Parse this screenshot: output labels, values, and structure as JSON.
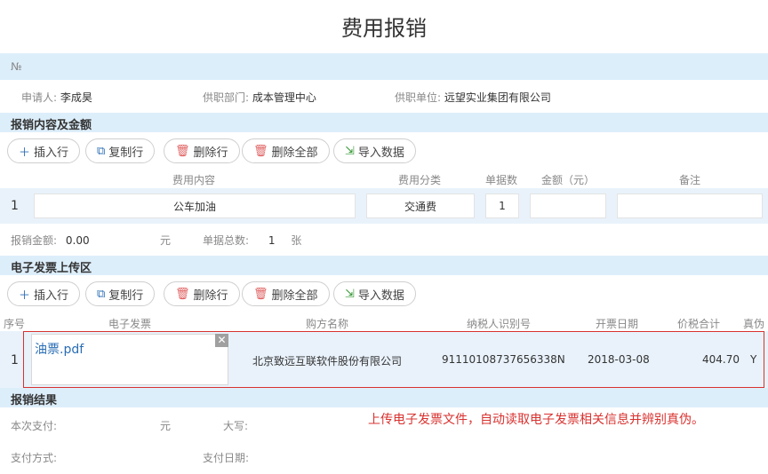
{
  "page_title": "费用报销",
  "no_label": "№",
  "applicant": {
    "label": "申请人:",
    "value": "李成昊"
  },
  "department": {
    "label": "供职部门:",
    "value": "成本管理中心"
  },
  "unit": {
    "label": "供职单位:",
    "value": "远望实业集团有限公司"
  },
  "expense_section": {
    "title": "报销内容及金额",
    "toolbar": {
      "insert": "插入行",
      "copy": "复制行",
      "delete": "删除行",
      "delete_all": "删除全部",
      "import": "导入数据"
    },
    "columns": {
      "content": "费用内容",
      "category": "费用分类",
      "docs": "单据数",
      "amount": "金额（元）",
      "remark": "备注"
    },
    "row": {
      "index": "1",
      "content": "公车加油",
      "category": "交通费",
      "docs": "1",
      "amount": "",
      "remark": ""
    },
    "summary": {
      "amount_label": "报销金额:",
      "amount_value": "0.00",
      "amount_unit": "元",
      "docs_label": "单据总数:",
      "docs_value": "1",
      "docs_unit": "张"
    }
  },
  "invoice_section": {
    "title": "电子发票上传区",
    "toolbar": {
      "insert": "插入行",
      "copy": "复制行",
      "delete": "删除行",
      "delete_all": "删除全部",
      "import": "导入数据"
    },
    "columns": {
      "seq": "序号",
      "invoice": "电子发票",
      "buyer": "购方名称",
      "taxpayer_id": "纳税人识别号",
      "date": "开票日期",
      "total": "价税合计",
      "authentic": "真伪"
    },
    "row": {
      "index": "1",
      "file": "油票.pdf",
      "buyer": "北京致远互联软件股份有限公司",
      "taxpayer_id": "91110108737656338N",
      "date": "2018-03-08",
      "total": "404.70",
      "authentic": "Y"
    }
  },
  "result_section": {
    "title": "报销结果",
    "pay_label": "本次支付:",
    "pay_unit": "元",
    "capital_label": "大写:",
    "method_label": "支付方式:",
    "date_label": "支付日期:"
  },
  "note": "上传电子发票文件，自动读取电子发票相关信息并辨别真伪。",
  "colors": {
    "band": "#ddeefb",
    "row_bg": "#e9f2fb",
    "highlight": "#d8322f",
    "link": "#2a6db5"
  }
}
